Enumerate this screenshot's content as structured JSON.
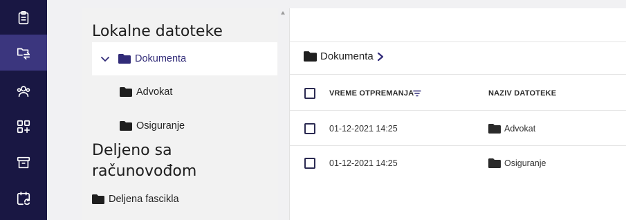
{
  "nav": {
    "items": [
      {
        "icon": "clipboard-icon",
        "active": false
      },
      {
        "icon": "file-transfer-icon",
        "active": true
      },
      {
        "icon": "users-icon",
        "active": false
      },
      {
        "icon": "add-apps-icon",
        "active": false
      },
      {
        "icon": "archive-icon",
        "active": false
      },
      {
        "icon": "calendar-sync-icon",
        "active": false
      }
    ]
  },
  "tree": {
    "local_heading": "Lokalne datoteke",
    "items": [
      {
        "label": "Dokumenta",
        "expanded": true,
        "selected": true
      },
      {
        "label": "Advokat"
      },
      {
        "label": "Osiguranje"
      }
    ],
    "shared_heading_line1": "Deljeno sa",
    "shared_heading_line2": "računovođom",
    "shared_items": [
      {
        "label": "Deljena fascikla"
      }
    ]
  },
  "main": {
    "breadcrumb": [
      "Dokumenta"
    ],
    "columns": {
      "date": "VREME OTPREMANJA",
      "name": "NAZIV DATOTEKE"
    },
    "rows": [
      {
        "date": "01-12-2021 14:25",
        "name": "Advokat"
      },
      {
        "date": "01-12-2021 14:25",
        "name": "Osiguranje"
      }
    ]
  },
  "colors": {
    "nav_bg": "#191743",
    "nav_active": "#3b367e",
    "accent": "#312b78"
  }
}
